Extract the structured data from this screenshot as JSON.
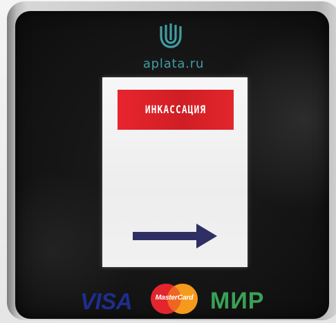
{
  "brand": {
    "name": "aplata.ru",
    "logo_icon": "aplata-shield-icon",
    "color": "#3f9ea3"
  },
  "screen": {
    "title": "ИНКАССАЦИЯ",
    "title_bg_color": "#e2262c",
    "next_icon": "arrow-right-icon",
    "arrow_color": "#2e2f63"
  },
  "payment_systems": {
    "visa": "VISA",
    "mastercard": "MasterCard",
    "mir": "МИР"
  }
}
